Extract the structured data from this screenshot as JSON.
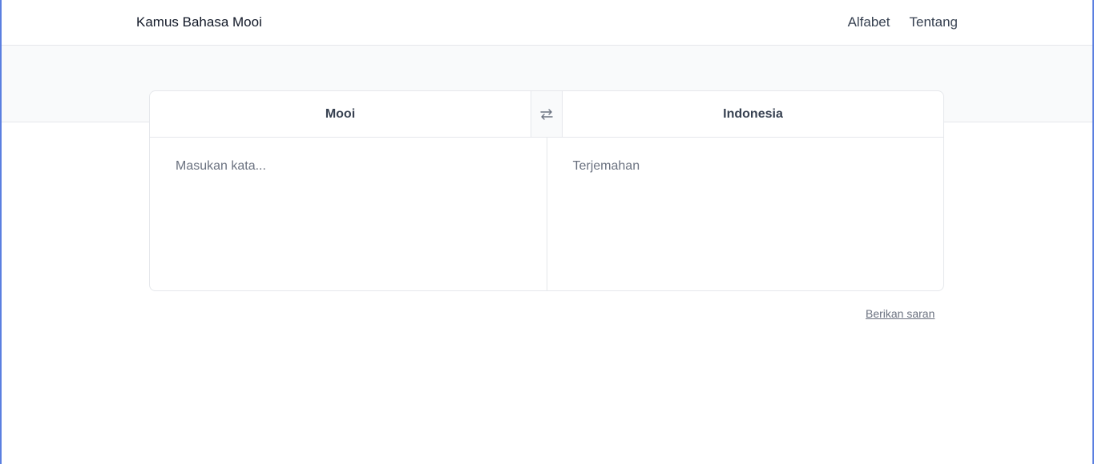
{
  "header": {
    "brand": "Kamus Bahasa Mooi",
    "nav": [
      "Alfabet",
      "Tentang"
    ]
  },
  "translator": {
    "source_lang": "Mooi",
    "target_lang": "Indonesia",
    "input_placeholder": "Masukan kata...",
    "input_value": "",
    "output_placeholder": "Terjemahan",
    "swap_icon": "swap-arrows-icon"
  },
  "footer": {
    "suggest_link": "Berikan saran"
  },
  "colors": {
    "frame_accent": "#5b7fe0",
    "band_bg": "#f9fafb",
    "border": "#e5e7eb",
    "muted_text": "#6b7280"
  }
}
